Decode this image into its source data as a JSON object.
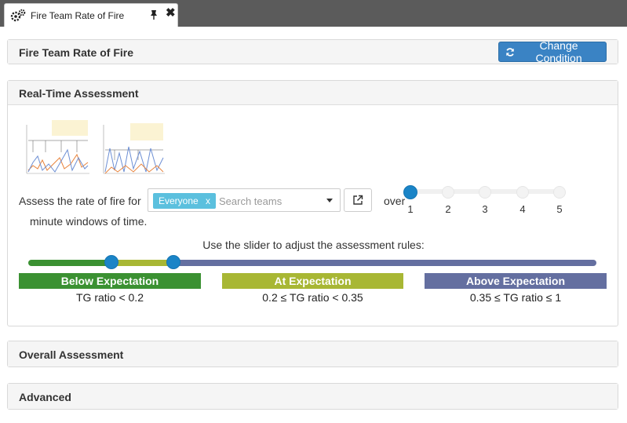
{
  "tab": {
    "title": "Fire Team Rate of Fire",
    "icon": "gears-icon",
    "pin_icon": "pin-icon",
    "close_icon": "close-icon",
    "close_glyph": "✖"
  },
  "header_panel": {
    "title": "Fire Team Rate of Fire",
    "change_condition_label": "Change Condition",
    "change_condition_icon": "refresh-icon"
  },
  "realtime": {
    "title": "Real-Time Assessment",
    "assess_prefix": "Assess the rate of fire for",
    "team_chip_label": "Everyone",
    "team_chip_remove": "x",
    "search_placeholder": "Search teams",
    "over_label": "over",
    "minute_suffix": "minute windows of time.",
    "minute_options": [
      "1",
      "2",
      "3",
      "4",
      "5"
    ],
    "minute_selected": "1",
    "slider_caption": "Use the slider to adjust the assessment rules:",
    "thresholds": [
      0.2,
      0.35
    ],
    "bands": [
      {
        "label": "Below Expectation",
        "rule": "TG ratio < 0.2",
        "color": "#3b9132"
      },
      {
        "label": "At Expectation",
        "rule": "0.2 ≤ TG ratio < 0.35",
        "color": "#a8b734"
      },
      {
        "label": "Above Expectation",
        "rule": "0.35 ≤ TG ratio ≤ 1",
        "color": "#646fa0"
      }
    ]
  },
  "overall": {
    "title": "Overall Assessment"
  },
  "advanced": {
    "title": "Advanced"
  },
  "colors": {
    "primary": "#3a83c4",
    "chip": "#5bc0de",
    "handle": "#1a84c7",
    "tab_bg": "#5b5b5b"
  }
}
